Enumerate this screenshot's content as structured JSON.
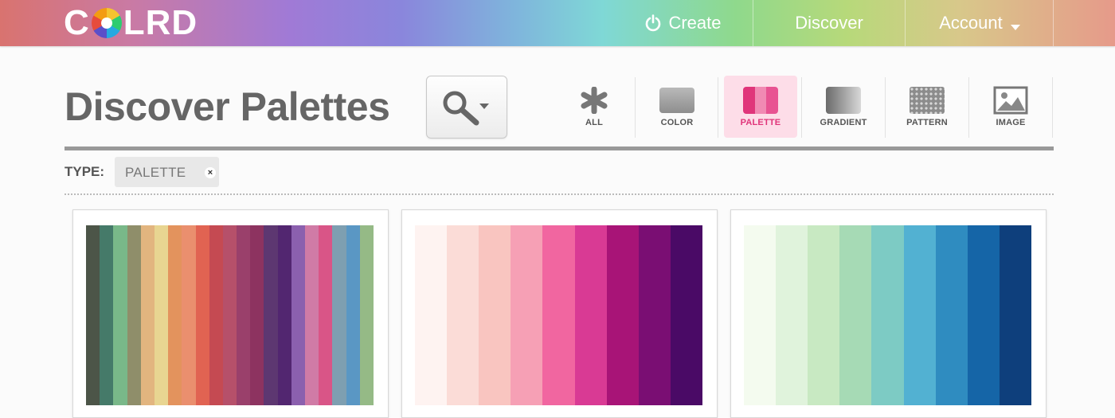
{
  "header": {
    "logo_text_left": "C",
    "logo_text_right": "LRD",
    "nav": [
      {
        "label": "Create",
        "icon": "power-icon"
      },
      {
        "label": "Discover"
      },
      {
        "label": "Account",
        "icon": "caret-down-icon"
      }
    ]
  },
  "page": {
    "title": "Discover Palettes",
    "search_icon": "magnifier-icon"
  },
  "filters": [
    {
      "label": "ALL",
      "icon": "asterisk-icon",
      "active": false
    },
    {
      "label": "COLOR",
      "icon": "color-swatch-icon",
      "active": false
    },
    {
      "label": "PALETTE",
      "icon": "palette-icon",
      "active": true
    },
    {
      "label": "GRADIENT",
      "icon": "gradient-icon",
      "active": false
    },
    {
      "label": "PATTERN",
      "icon": "pattern-icon",
      "active": false
    },
    {
      "label": "IMAGE",
      "icon": "image-icon",
      "active": false
    }
  ],
  "type_filter": {
    "label": "TYPE:",
    "tag": "PALETTE",
    "remove_glyph": "×"
  },
  "palettes": [
    {
      "colors": [
        "#4c5548",
        "#457a69",
        "#79b889",
        "#8f8e6a",
        "#e2b57f",
        "#e8d591",
        "#e3935d",
        "#ea8f6e",
        "#e16352",
        "#c54a52",
        "#b6506a",
        "#9a406b",
        "#8d3360",
        "#5d3771",
        "#522670",
        "#8b60ae",
        "#d07ba6",
        "#d95587",
        "#7e9fb1",
        "#5a97c4",
        "#95ba86"
      ]
    },
    {
      "colors": [
        "#fef3f1",
        "#fbdcd7",
        "#f9c5c0",
        "#f6a0b5",
        "#f166a0",
        "#d93a94",
        "#a81477",
        "#7a0e73",
        "#4a0a66"
      ]
    },
    {
      "colors": [
        "#f4fbef",
        "#e0f3dc",
        "#c8e9c2",
        "#a6dab5",
        "#7dcbc4",
        "#52b1d2",
        "#2f8cc0",
        "#1565a7",
        "#0e3f7c"
      ]
    }
  ]
}
